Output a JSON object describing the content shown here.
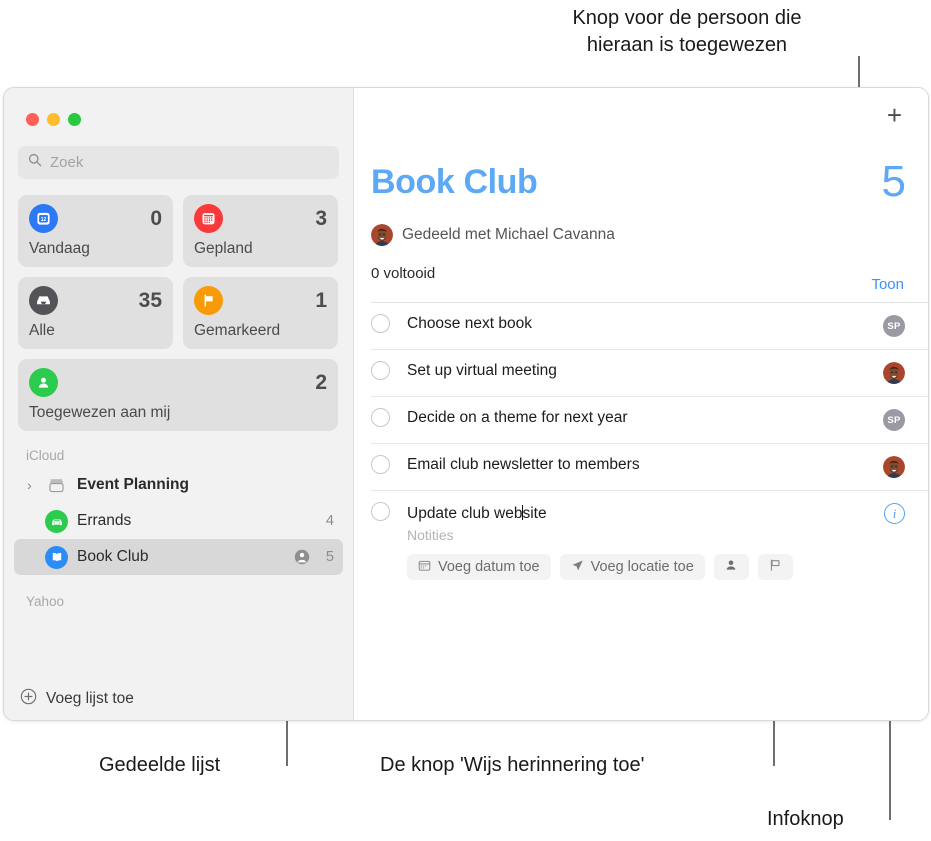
{
  "annotations": [
    {
      "id": "assignee-button",
      "text": "Knop voor de persoon die\nhieraan is toegewezen"
    },
    {
      "id": "shared-list",
      "text": "Gedeelde lijst"
    },
    {
      "id": "assign-reminder-button",
      "text": "De knop 'Wijs herinnering toe'"
    },
    {
      "id": "info-button",
      "text": "Infoknop"
    }
  ],
  "window": {
    "traffic_lights": [
      "close",
      "minimize",
      "zoom"
    ]
  },
  "sidebar": {
    "search": {
      "placeholder": "Zoek",
      "icon": "search-icon"
    },
    "smart_lists": [
      {
        "label": "Vandaag",
        "count": "0",
        "icon": "calendar-day-icon",
        "color": "#2b79f5"
      },
      {
        "label": "Gepland",
        "count": "3",
        "icon": "calendar-icon",
        "color": "#fa3a3a"
      },
      {
        "label": "Alle",
        "count": "35",
        "icon": "inbox-tray-icon",
        "color": "#545458"
      },
      {
        "label": "Gemarkeerd",
        "count": "1",
        "icon": "flag-icon",
        "color": "#f99b09"
      },
      {
        "label": "Toegewezen aan mij",
        "count": "2",
        "icon": "person-icon",
        "color": "#2ccb4e"
      }
    ],
    "sections": [
      {
        "title": "iCloud",
        "rows": [
          {
            "name": "Event Planning",
            "count": "",
            "icon": "group-folder-icon",
            "color": "",
            "type": "group",
            "bold": true,
            "expanded": false,
            "shared": false,
            "selected": false
          },
          {
            "name": "Errands",
            "count": "4",
            "icon": "car-icon",
            "color": "#2ccb4e",
            "type": "list",
            "bold": false,
            "shared": false,
            "selected": false
          },
          {
            "name": "Book Club",
            "count": "5",
            "icon": "book-icon",
            "color": "#2b8cf5",
            "type": "list",
            "bold": false,
            "shared": true,
            "selected": true
          }
        ]
      },
      {
        "title": "Yahoo",
        "rows": []
      }
    ],
    "add_list": {
      "label": "Voeg lijst toe",
      "icon": "plus-circle-icon"
    }
  },
  "detail": {
    "add_button_icon": "plus-icon",
    "title": "Book Club",
    "count": "5",
    "show_label": "Toon",
    "shared_with": "Gedeeld met Michael Cavanna",
    "shared_avatar": "photo-avatar",
    "completed_label": "0 voltooid",
    "accent_color": "#5da9f5",
    "reminders": [
      {
        "title": "Choose next book",
        "notes": "",
        "badge": "initials",
        "initials": "SP",
        "editing": false
      },
      {
        "title": "Set up virtual meeting",
        "notes": "",
        "badge": "photo",
        "initials": "",
        "editing": false
      },
      {
        "title": "Decide on a theme for next year",
        "notes": "",
        "badge": "initials",
        "initials": "SP",
        "editing": false
      },
      {
        "title": "Email club newsletter to members",
        "notes": "",
        "badge": "photo",
        "initials": "",
        "editing": false
      },
      {
        "title": "Update club website",
        "notes": "Notities",
        "badge": "info",
        "initials": "",
        "editing": true
      }
    ],
    "editor_actions": [
      {
        "label": "Voeg datum toe",
        "icon": "calendar-small-icon"
      },
      {
        "label": "Voeg locatie toe",
        "icon": "location-arrow-icon"
      },
      {
        "label": "",
        "icon": "person-small-icon"
      },
      {
        "label": "",
        "icon": "flag-outline-icon"
      }
    ]
  }
}
